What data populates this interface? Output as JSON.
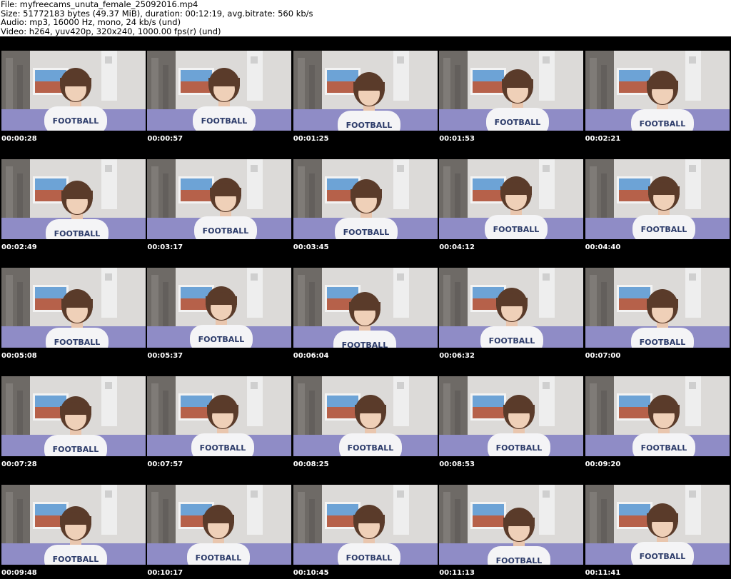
{
  "header": {
    "file_line": "File: myfreecams_unuta_female_25092016.mp4",
    "size_line": "Size: 51772183 bytes (49.37 MiB), duration: 00:12:19, avg.bitrate: 560 kb/s",
    "audio_line": "Audio: mp3, 16000 Hz, mono, 24 kb/s (und)",
    "video_line": "Video: h264, yuv420p, 320x240, 1000.00 fps(r) (und)"
  },
  "frames": [
    {
      "timestamp": "00:00:28"
    },
    {
      "timestamp": "00:00:57"
    },
    {
      "timestamp": "00:01:25"
    },
    {
      "timestamp": "00:01:53"
    },
    {
      "timestamp": "00:02:21"
    },
    {
      "timestamp": "00:02:49"
    },
    {
      "timestamp": "00:03:17"
    },
    {
      "timestamp": "00:03:45"
    },
    {
      "timestamp": "00:04:12"
    },
    {
      "timestamp": "00:04:40"
    },
    {
      "timestamp": "00:05:08"
    },
    {
      "timestamp": "00:05:37"
    },
    {
      "timestamp": "00:06:04"
    },
    {
      "timestamp": "00:06:32"
    },
    {
      "timestamp": "00:07:00"
    },
    {
      "timestamp": "00:07:28"
    },
    {
      "timestamp": "00:07:57"
    },
    {
      "timestamp": "00:08:25"
    },
    {
      "timestamp": "00:08:53"
    },
    {
      "timestamp": "00:09:20"
    },
    {
      "timestamp": "00:09:48"
    },
    {
      "timestamp": "00:10:17"
    },
    {
      "timestamp": "00:10:45"
    },
    {
      "timestamp": "00:11:13"
    },
    {
      "timestamp": "00:11:41"
    }
  ],
  "thumbnail_text": "FOOTBALL",
  "colors": {
    "background": "#000000",
    "wall": "#dcdad8",
    "bed": "#8f8cc6",
    "shirt": "#f4f4f6",
    "hair": "#5a3b2a",
    "curtain": "#6e6a66"
  }
}
